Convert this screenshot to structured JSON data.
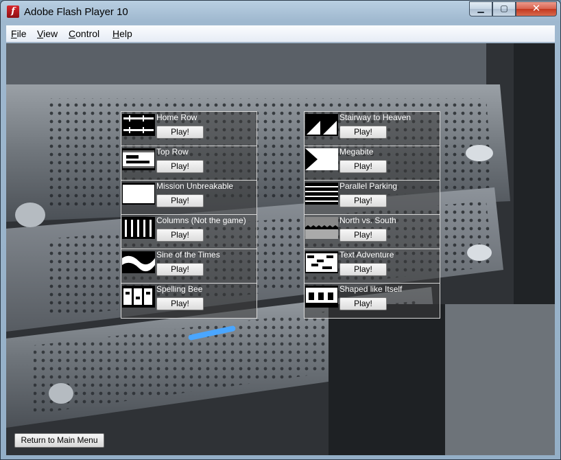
{
  "window": {
    "title": "Adobe Flash Player 10",
    "icon": "flash-icon",
    "icon_glyph": "f",
    "minimize_glyph": "▁",
    "maximize_glyph": "▢",
    "close_glyph": "✕"
  },
  "menu": [
    {
      "key": "F",
      "rest": "ile"
    },
    {
      "key": "V",
      "rest": "iew"
    },
    {
      "key": "C",
      "rest": "ontrol"
    },
    {
      "key": "H",
      "rest": "elp"
    }
  ],
  "levels_left": [
    {
      "title": "Home Row",
      "button": "Play!",
      "thumb": "home-row"
    },
    {
      "title": "Top Row",
      "button": "Play!",
      "thumb": "top-row"
    },
    {
      "title": "Mission Unbreakable",
      "button": "Play!",
      "thumb": "mission"
    },
    {
      "title": "Columns (Not the game)",
      "button": "Play!",
      "thumb": "columns"
    },
    {
      "title": "Sine of the Times",
      "button": "Play!",
      "thumb": "sine"
    },
    {
      "title": "Spelling Bee",
      "button": "Play!",
      "thumb": "spelling"
    }
  ],
  "levels_right": [
    {
      "title": "Stairway to Heaven",
      "button": "Play!",
      "thumb": "stairway"
    },
    {
      "title": "Megabite",
      "button": "Play!",
      "thumb": "megabite"
    },
    {
      "title": "Parallel Parking",
      "button": "Play!",
      "thumb": "parallel"
    },
    {
      "title": "North vs. South",
      "button": "Play!",
      "thumb": "north-south"
    },
    {
      "title": "Text Adventure",
      "button": "Play!",
      "thumb": "text-adventure"
    },
    {
      "title": "Shaped like Itself",
      "button": "Play!",
      "thumb": "shaped"
    }
  ],
  "footer": {
    "return_label": "Return to Main Menu"
  }
}
